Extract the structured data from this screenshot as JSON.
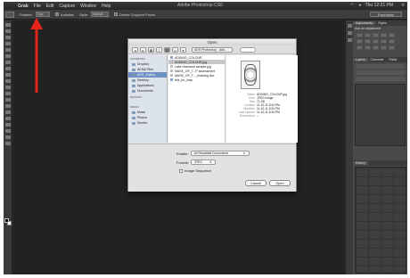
{
  "menubar": {
    "app": "Grab",
    "menus": [
      "File",
      "Edit",
      "Capture",
      "Window",
      "Help"
    ],
    "window_title": "Adobe Photoshop CS6",
    "clock": "Thu 12:21 PM"
  },
  "options_bar": {
    "feather_label": "Feather:",
    "feather_value": "0 px",
    "antialias_label": "Antialias",
    "style_label": "Style:",
    "style_value": "Normal",
    "delete_cropped_label": "Delete Cropped Pixels",
    "workspace": "Essentials"
  },
  "dialog": {
    "title": "Open",
    "path": "ADS Photoshop - Add...",
    "sidebar": {
      "favorites_heading": "FAVORITES",
      "devices_heading": "DEVICES",
      "favorites": [
        "Dropbox",
        "All My Files",
        "ADS_Gallery",
        "Desktop",
        "Applications",
        "Documents"
      ],
      "selected_index": 2,
      "media_heading": "MEDIA",
      "media": [
        "Music",
        "Photos",
        "Movies"
      ]
    },
    "files": [
      "ADDING_COLOUR",
      "ADDING_COLOUR.jpg",
      "Lake Harmand sample.jpg",
      "MASK_OF_T...P assessment",
      "MASK_OF_T..._marking.doc",
      "this_for_leap"
    ],
    "selected_file_index": 1,
    "preview_meta": [
      {
        "k": "Name",
        "v": "ADDING_COLOUR.jpg"
      },
      {
        "k": "Kind",
        "v": "JPEG image"
      },
      {
        "k": "Size",
        "v": "71 KB"
      },
      {
        "k": "Created",
        "v": "11-10-11 8:34 PM"
      },
      {
        "k": "Modified",
        "v": "11-10-11 8:34 PM"
      },
      {
        "k": "Last opened",
        "v": "11-10-11 8:34 PM"
      },
      {
        "k": "Dimensions",
        "v": "--"
      }
    ],
    "enable_label": "Enable:",
    "enable_value": "All Readable Documents",
    "format_label": "Format:",
    "format_value": "JPEG",
    "image_sequence_label": "Image Sequence",
    "cancel_label": "Cancel",
    "open_label": "Open"
  },
  "panels": {
    "adjustments_tabs": [
      "Adjustments",
      "Styles"
    ],
    "adjustments_title": "Add an adjustment",
    "layers_tabs": [
      "Layers",
      "Channels",
      "Paths"
    ],
    "history_tab": "History"
  },
  "colors": {
    "annotation_arrow": "#e5231b",
    "sidebar_selection": "#6d8fc4"
  }
}
